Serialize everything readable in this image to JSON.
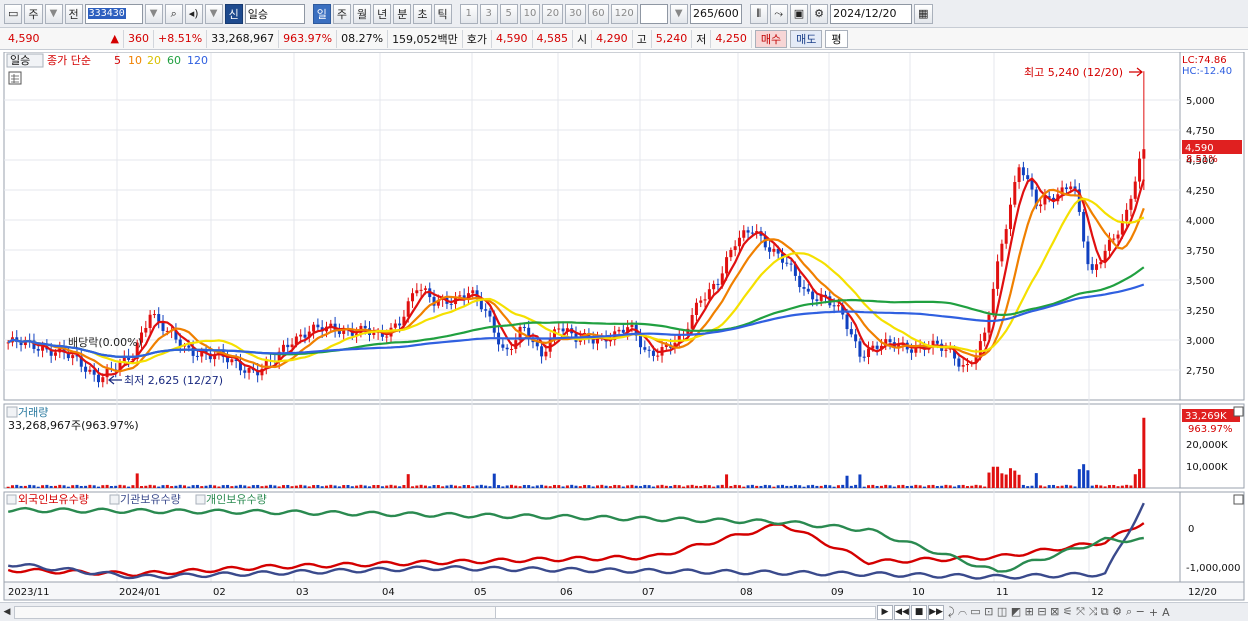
{
  "toolbar": {
    "market_label": "주",
    "prev_label": "전",
    "stock_code": "333430",
    "new_badge": "신",
    "stock_name": "일승",
    "period_buttons": [
      "일",
      "주",
      "월",
      "년",
      "분",
      "초",
      "틱"
    ],
    "active_period": "일",
    "interval_buttons": [
      "1",
      "3",
      "5",
      "10",
      "20",
      "30",
      "60",
      "120"
    ],
    "data_count": "265",
    "data_count_max": "/600",
    "date": "2024/12/20"
  },
  "quote": {
    "price": "4,590",
    "change_arrow": "▲",
    "change": "360",
    "change_pct": "+8.51%",
    "volume": "33,268,967",
    "volume_ratio": "963.97%",
    "turnover": "08.27%",
    "amount": "159,052백만",
    "bid_label": "호가",
    "bid": "4,590",
    "ask": "4,585",
    "open_label": "시",
    "open": "4,290",
    "high_label": "고",
    "high": "5,240",
    "low_label": "저",
    "low": "4,250",
    "buy_label": "매수",
    "sell_label": "매도",
    "eq_label": "평"
  },
  "price_panel": {
    "legend_daily": "일승",
    "legend_ma": "종가 단순",
    "ma_periods": [
      "5",
      "10",
      "20",
      "60",
      "120"
    ],
    "ma_colors": [
      "#e01010",
      "#f08000",
      "#f5e000",
      "#20a040",
      "#3060e0"
    ],
    "lc_label": "LC:74.86",
    "hc_label": "HC:-12.40",
    "last_price_tag": "4,590",
    "last_pct_tag": "8.51%",
    "high_annotation": "최고 5,240 (12/20)",
    "low_annotation": "최저 2,625 (12/27)",
    "dividend_annotation": "배당락(0.00%)",
    "y_ticks": [
      "5,000",
      "4,750",
      "4,500",
      "4,250",
      "4,000",
      "3,750",
      "3,500",
      "3,250",
      "3,000",
      "2,750"
    ]
  },
  "volume_panel": {
    "title": "거래량",
    "value_text": "33,268,967주(963.97%)",
    "last_tag": "33,269K",
    "last_pct": "963.97%",
    "y_ticks": [
      "20,000K",
      "10,000K"
    ]
  },
  "holdings_panel": {
    "legend": [
      "외국인보유수량",
      "기관보유수량",
      "개인보유수량"
    ],
    "legend_colors": [
      "#d40000",
      "#3a4a8c",
      "#2a8a50"
    ],
    "y_ticks": [
      "0",
      "-1,000,000"
    ]
  },
  "x_axis": {
    "labels": [
      "2023/11",
      "2024/01",
      "02",
      "03",
      "04",
      "05",
      "06",
      "07",
      "08",
      "09",
      "10",
      "11",
      "12"
    ],
    "right_label": "12/20"
  },
  "chart_data": {
    "type": "candlestick",
    "x_range": [
      "2023-11",
      "2024-12-20"
    ],
    "ylim": [
      2625,
      5240
    ],
    "high": 5240,
    "low": 2625,
    "last": 4590,
    "open": 4290,
    "close_path": [
      2980,
      2960,
      2940,
      2900,
      2800,
      2700,
      2760,
      2850,
      3250,
      3050,
      2920,
      2900,
      2850,
      2780,
      2750,
      2820,
      3000,
      3100,
      3080,
      3080,
      3100,
      3000,
      3150,
      3450,
      3300,
      3350,
      3400,
      3200,
      2900,
      3100,
      2850,
      3150,
      3000,
      3000,
      3050,
      3100,
      2880,
      2950,
      3000,
      3350,
      3500,
      3800,
      3950,
      3750,
      3600,
      3400,
      3350,
      3200,
      2900,
      2950,
      2950,
      2950,
      2950,
      2900,
      2780,
      3000,
      3800,
      4500,
      4100,
      4200,
      4350,
      3500,
      3800,
      4050,
      4590
    ]
  }
}
